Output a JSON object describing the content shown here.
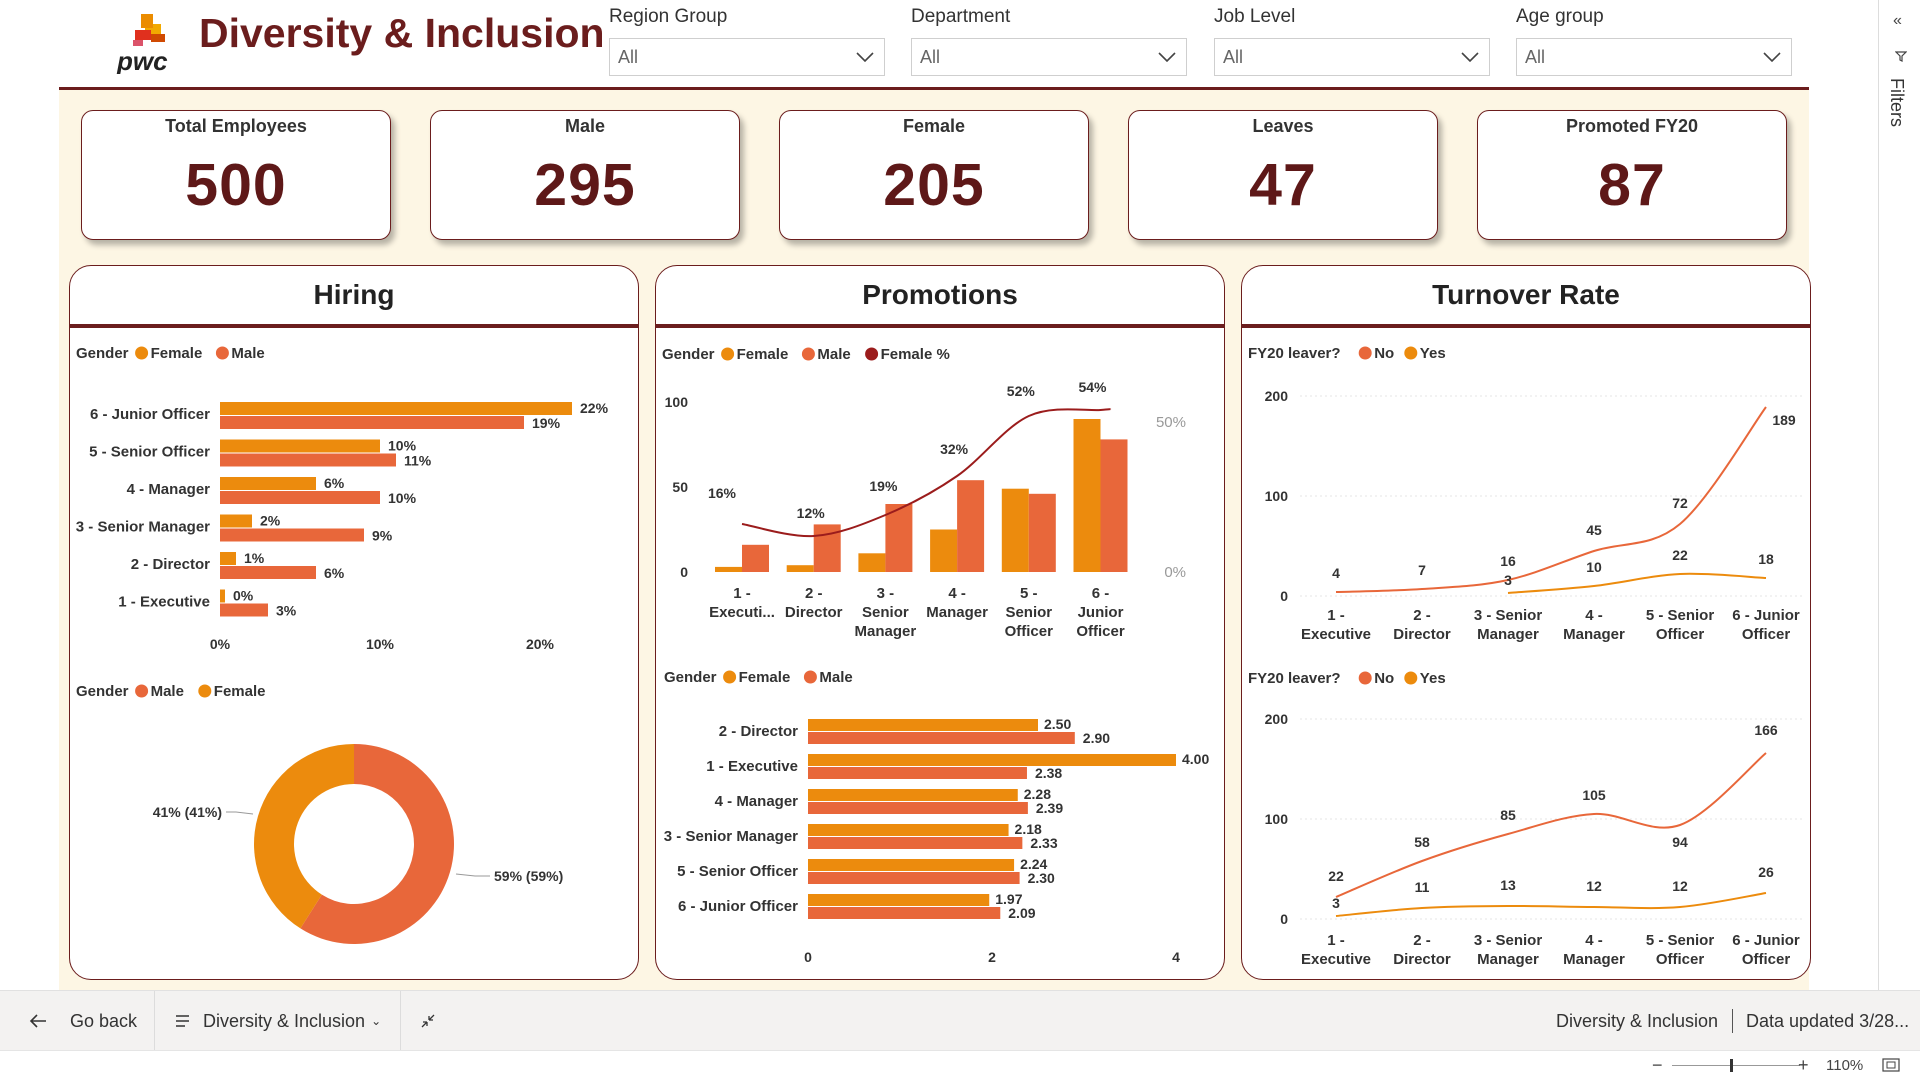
{
  "header": {
    "logo_text": "pwc",
    "title": "Diversity & Inclusion",
    "slicers": [
      {
        "label": "Region Group",
        "value": "All"
      },
      {
        "label": "Department",
        "value": "All"
      },
      {
        "label": "Job Level",
        "value": "All"
      },
      {
        "label": "Age group",
        "value": "All"
      }
    ]
  },
  "kpis": [
    {
      "title": "Total Employees",
      "value": "500"
    },
    {
      "title": "Male",
      "value": "295"
    },
    {
      "title": "Female",
      "value": "205"
    },
    {
      "title": "Leaves",
      "value": "47"
    },
    {
      "title": "Promoted FY20",
      "value": "87"
    }
  ],
  "panels": {
    "hiring": "Hiring",
    "promotions": "Promotions",
    "turnover": "Turnover Rate"
  },
  "legends": {
    "hiring_bar": {
      "field": "Gender",
      "items": [
        "Female",
        "Male"
      ]
    },
    "hiring_donut": {
      "field": "Gender",
      "items": [
        "Male",
        "Female"
      ]
    },
    "promo_combo": {
      "field": "Gender",
      "items": [
        "Female",
        "Male",
        "Female %"
      ]
    },
    "promo_bar": {
      "field": "Gender",
      "items": [
        "Female",
        "Male"
      ]
    },
    "turn1": {
      "field": "FY20 leaver?",
      "items": [
        "No",
        "Yes"
      ]
    },
    "turn2": {
      "field": "FY20 leaver?",
      "items": [
        "No",
        "Yes"
      ]
    }
  },
  "colors": {
    "female": "#ec8b0d",
    "male": "#e8673a",
    "female_pct": "#9b1c1c",
    "brand": "#6b1d1d",
    "canvas": "#fdf6e4"
  },
  "bottom": {
    "go_back": "Go back",
    "page": "Diversity & Inclusion",
    "report_name": "Diversity & Inclusion",
    "updated": "Data updated 3/28...",
    "zoom": "110%",
    "filters": "Filters"
  },
  "chart_data": [
    {
      "id": "hiring_bar",
      "type": "bar",
      "orientation": "horizontal",
      "categories": [
        "6 - Junior Officer",
        "5 - Senior Officer",
        "4 - Manager",
        "3 - Senior Manager",
        "2 - Director",
        "1 - Executive"
      ],
      "series": [
        {
          "name": "Female",
          "values": [
            22,
            10,
            6,
            2,
            1,
            0
          ],
          "labels": [
            "22%",
            "10%",
            "6%",
            "2%",
            "1%",
            "0%"
          ]
        },
        {
          "name": "Male",
          "values": [
            19,
            11,
            10,
            9,
            6,
            3
          ],
          "labels": [
            "19%",
            "11%",
            "10%",
            "9%",
            "6%",
            "3%"
          ]
        }
      ],
      "xlim": [
        0,
        25
      ],
      "xticks": [
        "0%",
        "10%",
        "20%"
      ]
    },
    {
      "id": "hiring_donut",
      "type": "pie",
      "categories": [
        "Male",
        "Female"
      ],
      "values": [
        59,
        41
      ],
      "labels": [
        "59% (59%)",
        "41% (41%)"
      ]
    },
    {
      "id": "promo_combo",
      "type": "bar",
      "categories": [
        "1 - Executi...",
        "2 - Director",
        "3 - Senior Manager",
        "4 - Manager",
        "5 - Senior Officer",
        "6 - Junior Officer"
      ],
      "series": [
        {
          "name": "Female",
          "values": [
            3,
            4,
            11,
            25,
            49,
            90
          ]
        },
        {
          "name": "Male",
          "values": [
            16,
            28,
            40,
            54,
            46,
            78
          ]
        },
        {
          "name": "Female %",
          "type": "line",
          "values": [
            16,
            12,
            19,
            32,
            52,
            54
          ],
          "labels": [
            "16%",
            "12%",
            "19%",
            "32%",
            "52%",
            "54%"
          ]
        }
      ],
      "ylim": [
        0,
        100
      ],
      "yticks": [
        "100",
        "50",
        "0"
      ],
      "y2ticks": [
        "50%",
        "0%"
      ]
    },
    {
      "id": "promo_bar",
      "type": "bar",
      "orientation": "horizontal",
      "categories": [
        "2 - Director",
        "1 - Executive",
        "4 - Manager",
        "3 - Senior Manager",
        "5 - Senior Officer",
        "6 - Junior Officer"
      ],
      "series": [
        {
          "name": "Female",
          "values": [
            2.5,
            4.0,
            2.28,
            2.18,
            2.24,
            1.97
          ],
          "labels": [
            "2.50",
            "4.00",
            "2.28",
            "2.18",
            "2.24",
            "1.97"
          ]
        },
        {
          "name": "Male",
          "values": [
            2.9,
            2.38,
            2.39,
            2.33,
            2.3,
            2.09
          ],
          "labels": [
            "2.90",
            "2.38",
            "2.39",
            "2.33",
            "2.30",
            "2.09"
          ]
        }
      ],
      "xlim": [
        0,
        4
      ],
      "xticks": [
        "0",
        "2",
        "4"
      ]
    },
    {
      "id": "turn1",
      "type": "line",
      "categories": [
        "1 - Executive",
        "2 - Director",
        "3 - Senior Manager",
        "4 - Manager",
        "5 - Senior Officer",
        "6 - Junior Officer"
      ],
      "series": [
        {
          "name": "No",
          "values": [
            4,
            7,
            16,
            45,
            72,
            189
          ]
        },
        {
          "name": "Yes",
          "values": [
            null,
            null,
            3,
            10,
            22,
            18
          ]
        }
      ],
      "ylim": [
        0,
        200
      ],
      "yticks": [
        "200",
        "100",
        "0"
      ]
    },
    {
      "id": "turn2",
      "type": "line",
      "categories": [
        "1 - Executive",
        "2 - Director",
        "3 - Senior Manager",
        "4 - Manager",
        "5 - Senior Officer",
        "6 - Junior Officer"
      ],
      "series": [
        {
          "name": "No",
          "values": [
            22,
            58,
            85,
            105,
            94,
            166
          ]
        },
        {
          "name": "Yes",
          "values": [
            3,
            11,
            13,
            12,
            12,
            26
          ]
        }
      ],
      "ylim": [
        0,
        200
      ],
      "yticks": [
        "200",
        "100",
        "0"
      ]
    }
  ]
}
